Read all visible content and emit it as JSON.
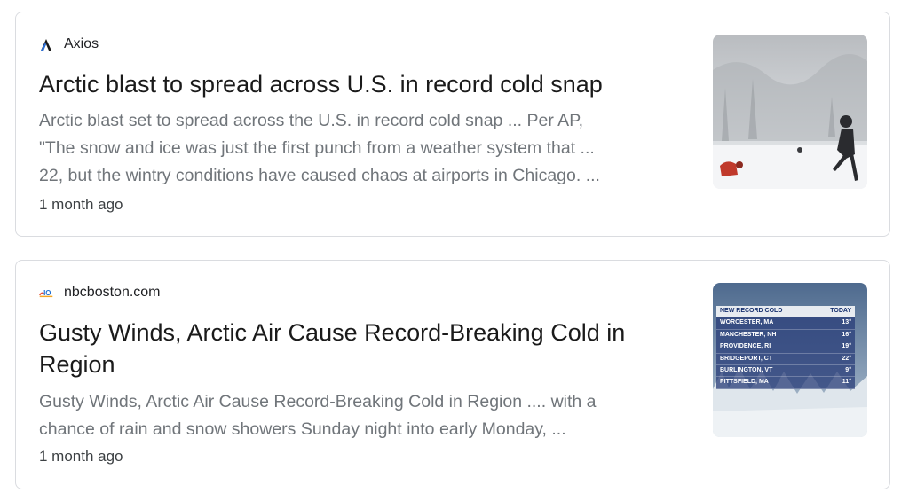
{
  "results": [
    {
      "source": "Axios",
      "favicon": "axios-logo-icon",
      "title": "Arctic blast to spread across U.S. in record cold snap",
      "snippet_lines": [
        "Arctic blast set to spread across the U.S. in record cold snap ... Per AP,",
        "\"The snow and ice was just the first punch from a weather system that ...",
        "22, but the wintry conditions have caused chaos at airports in Chicago. ..."
      ],
      "age": "1 month ago",
      "thumbnail": "snowy-park-photo"
    },
    {
      "source": "nbcboston.com",
      "favicon": "nbc-boston-logo-icon",
      "title_lines": [
        "Gusty Winds, Arctic Air Cause Record-Breaking Cold in",
        "Region"
      ],
      "snippet_lines": [
        "Gusty Winds, Arctic Air Cause Record-Breaking Cold in Region .... with a",
        "chance of rain and snow showers Sunday night into early Monday, ..."
      ],
      "age": "1 month ago",
      "thumbnail": "record-cold-graphic",
      "thumbnail_table": {
        "header_left": "NEW RECORD COLD",
        "header_right": "TODAY",
        "rows": [
          {
            "place": "WORCESTER, MA",
            "temp": "13°"
          },
          {
            "place": "MANCHESTER, NH",
            "temp": "16°"
          },
          {
            "place": "PROVIDENCE, RI",
            "temp": "19°"
          },
          {
            "place": "BRIDGEPORT, CT",
            "temp": "22°"
          },
          {
            "place": "BURLINGTON, VT",
            "temp": "9°"
          },
          {
            "place": "PITTSFIELD, MA",
            "temp": "11°"
          }
        ]
      }
    }
  ]
}
